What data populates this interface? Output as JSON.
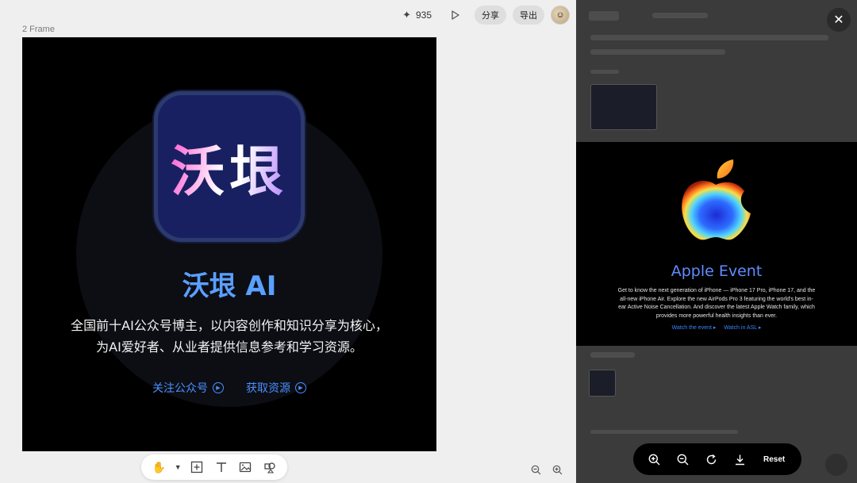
{
  "topbar": {
    "credits": "935",
    "share_label": "分享",
    "export_label": "导出"
  },
  "canvas": {
    "frame_label": "2 Frame",
    "artboard": {
      "icon_text": "沃垠",
      "title": "沃垠 AI",
      "desc_line1": "全国前十AI公众号博主，以内容创作和知识分享为核心，",
      "desc_line2": "为AI爱好者、从业者提供信息参考和学习资源。",
      "link1": "关注公众号",
      "link2": "获取资源"
    }
  },
  "preview": {
    "title": "Apple Event",
    "body": "Get to know the next generation of iPhone — iPhone 17 Pro, iPhone 17, and the all-new iPhone Air. Explore the new AirPods Pro 3 featuring the world's best in-ear Active Noise Cancellation. And discover the latest Apple Watch family, which provides more powerful health insights than ever.",
    "link1": "Watch the event",
    "link2": "Watch in ASL"
  },
  "viewer": {
    "reset_label": "Reset"
  },
  "colors": {
    "accent_blue": "#4a8fff",
    "artboard_bg": "#000000",
    "icon_bg": "#182062"
  }
}
